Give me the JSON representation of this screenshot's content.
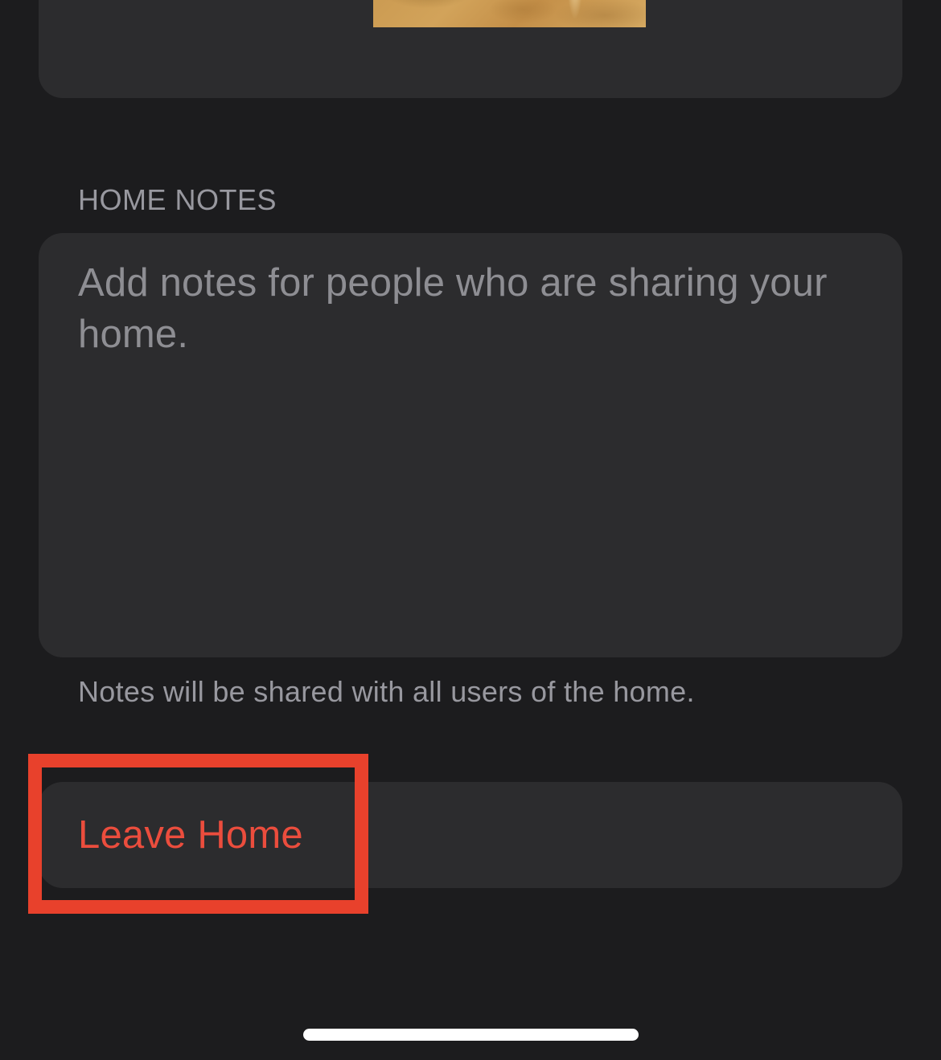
{
  "wallpaper": {
    "icon": "wallpaper-image"
  },
  "home_notes": {
    "header": "HOME NOTES",
    "placeholder": "Add notes for people who are sharing your home.",
    "value": "",
    "footer": "Notes will be shared with all users of the home."
  },
  "leave_home": {
    "label": "Leave Home",
    "color": "#eb4d3d"
  },
  "annotation": {
    "highlight_color": "#e8412c"
  },
  "colors": {
    "background": "#1c1c1e",
    "card": "#2c2c2e",
    "secondary_text": "#98989f",
    "destructive": "#eb4d3d"
  }
}
